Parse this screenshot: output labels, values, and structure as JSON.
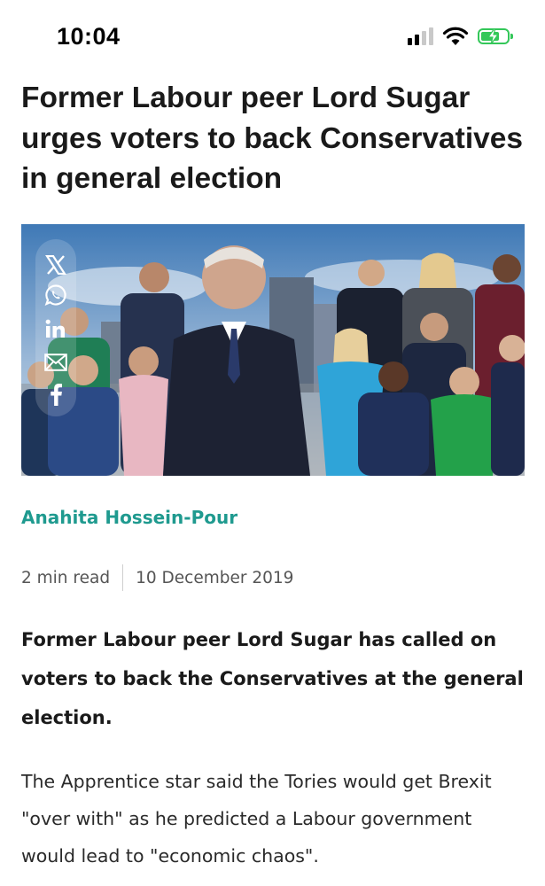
{
  "status_bar": {
    "time": "10:04",
    "icons": [
      "cellular-signal-icon",
      "wifi-icon",
      "battery-charging-icon"
    ],
    "signal_level": 0.5,
    "battery_level": 0.75,
    "battery_color": "#34c759"
  },
  "article": {
    "headline": "Former Labour peer Lord Sugar urges voters to back Conservatives in general election",
    "author": "Anahita Hossein-Pour",
    "read_time": "2 min read",
    "date": "10 December 2019",
    "lead": "Former Labour peer Lord Sugar has called on voters to back the Conservatives at the general election.",
    "body": "The Apprentice star said the Tories would get Brexit \"over with\" as he predicted a Labour government would lead to \"economic chaos\"."
  },
  "share": {
    "icons": [
      "x-icon",
      "whatsapp-icon",
      "linkedin-icon",
      "email-icon",
      "facebook-icon"
    ]
  },
  "colors": {
    "author_link": "#1f9a8f",
    "headline": "#1a1a1a",
    "meta": "#555555"
  }
}
